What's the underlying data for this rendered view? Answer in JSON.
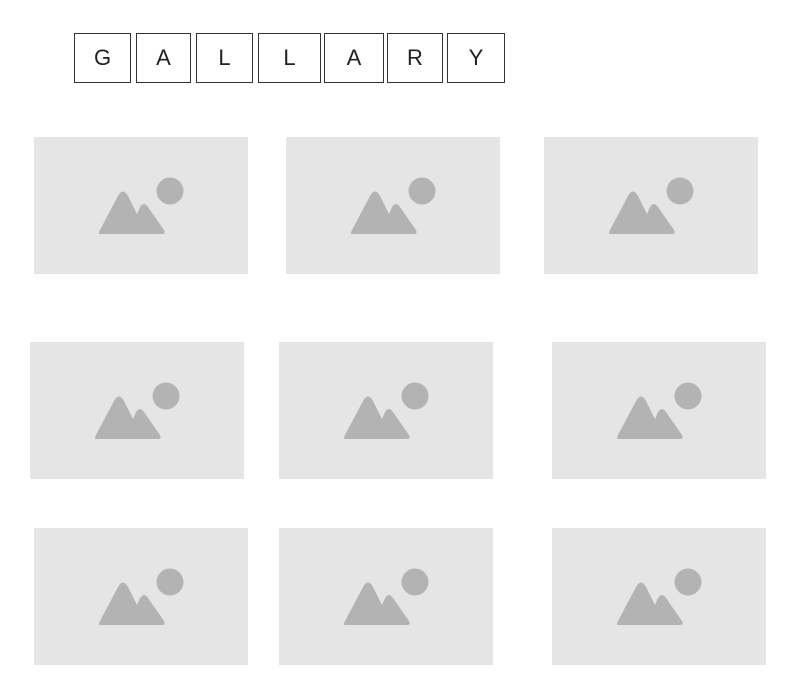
{
  "header": {
    "letters": [
      "G",
      "A",
      "L",
      "L",
      "A",
      "R",
      "Y"
    ]
  },
  "gallery": {
    "placeholder_icon": "image-placeholder-icon",
    "tile_color": "#e5e5e5",
    "icon_color": "#b3b3b3",
    "tile_count": 9
  }
}
